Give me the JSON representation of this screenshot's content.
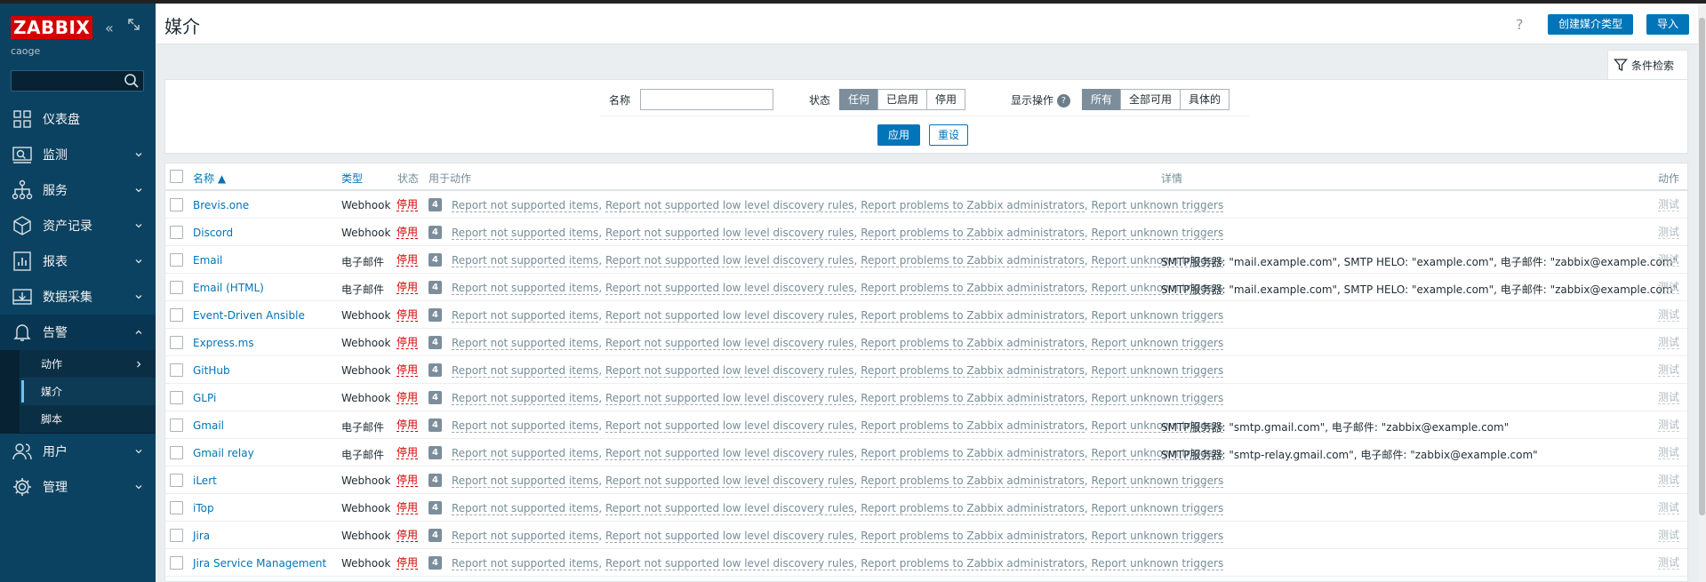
{
  "app": {
    "logo": "ZABBIX",
    "server_name": "caoge"
  },
  "sidebar": {
    "search_placeholder": "",
    "items": [
      {
        "label": "仪表盘",
        "icon": "dashboard-icon"
      },
      {
        "label": "监测",
        "icon": "monitoring-icon"
      },
      {
        "label": "服务",
        "icon": "services-icon"
      },
      {
        "label": "资产记录",
        "icon": "inventory-icon"
      },
      {
        "label": "报表",
        "icon": "reports-icon"
      },
      {
        "label": "数据采集",
        "icon": "data-collection-icon"
      },
      {
        "label": "告警",
        "icon": "bell-icon"
      },
      {
        "label": "用户",
        "icon": "users-icon"
      },
      {
        "label": "管理",
        "icon": "gear-icon"
      }
    ],
    "alerts_sub": [
      {
        "label": "动作"
      },
      {
        "label": "媒介"
      },
      {
        "label": "脚本"
      }
    ]
  },
  "header": {
    "title": "媒介",
    "help": "?",
    "create_button": "创建媒介类型",
    "import_button": "导入"
  },
  "filter": {
    "tab_label": "条件检索",
    "name_label": "名称",
    "name_value": "",
    "status_label": "状态",
    "status_options": [
      "任何",
      "已启用",
      "停用"
    ],
    "status_selected": "任何",
    "show_ops_label": "显示操作",
    "show_ops_help": "?",
    "show_ops_options": [
      "所有",
      "全部可用",
      "具体的"
    ],
    "show_ops_selected": "所有",
    "apply_button": "应用",
    "reset_button": "重设"
  },
  "table": {
    "columns": {
      "name": "名称 ▲",
      "type": "类型",
      "status": "状态",
      "used_in": "用于动作",
      "details": "详情",
      "action": "动作"
    },
    "rows": [
      {
        "name": "Brevis.one",
        "type": "Webhook",
        "status": "停用",
        "count": "4",
        "details": "",
        "test": "测试"
      },
      {
        "name": "Discord",
        "type": "Webhook",
        "status": "停用",
        "count": "4",
        "details": "",
        "test": "测试"
      },
      {
        "name": "Email",
        "type": "电子邮件",
        "status": "停用",
        "count": "4",
        "details": "SMTP服务器: \"mail.example.com\", SMTP HELO: \"example.com\", 电子邮件: \"zabbix@example.com\"",
        "test": "测试"
      },
      {
        "name": "Email (HTML)",
        "type": "电子邮件",
        "status": "停用",
        "count": "4",
        "details": "SMTP服务器: \"mail.example.com\", SMTP HELO: \"example.com\", 电子邮件: \"zabbix@example.com\"",
        "test": "测试"
      },
      {
        "name": "Event-Driven Ansible",
        "type": "Webhook",
        "status": "停用",
        "count": "4",
        "details": "",
        "test": "测试"
      },
      {
        "name": "Express.ms",
        "type": "Webhook",
        "status": "停用",
        "count": "4",
        "details": "",
        "test": "测试"
      },
      {
        "name": "GitHub",
        "type": "Webhook",
        "status": "停用",
        "count": "4",
        "details": "",
        "test": "测试"
      },
      {
        "name": "GLPi",
        "type": "Webhook",
        "status": "停用",
        "count": "4",
        "details": "",
        "test": "测试"
      },
      {
        "name": "Gmail",
        "type": "电子邮件",
        "status": "停用",
        "count": "4",
        "details": "SMTP服务器: \"smtp.gmail.com\", 电子邮件: \"zabbix@example.com\"",
        "test": "测试"
      },
      {
        "name": "Gmail relay",
        "type": "电子邮件",
        "status": "停用",
        "count": "4",
        "details": "SMTP服务器: \"smtp-relay.gmail.com\", 电子邮件: \"zabbix@example.com\"",
        "test": "测试"
      },
      {
        "name": "iLert",
        "type": "Webhook",
        "status": "停用",
        "count": "4",
        "details": "",
        "test": "测试"
      },
      {
        "name": "iTop",
        "type": "Webhook",
        "status": "停用",
        "count": "4",
        "details": "",
        "test": "测试"
      },
      {
        "name": "Jira",
        "type": "Webhook",
        "status": "停用",
        "count": "4",
        "details": "",
        "test": "测试"
      },
      {
        "name": "Jira Service Management",
        "type": "Webhook",
        "status": "停用",
        "count": "4",
        "details": "",
        "test": "测试"
      }
    ],
    "actions": [
      "Report not supported items",
      "Report not supported low level discovery rules",
      "Report problems to Zabbix administrators",
      "Report unknown triggers"
    ],
    "action_sep": ", "
  },
  "colors": {
    "sidebar_bg": "#0b4261",
    "accent": "#0275b8",
    "disabled_red": "#d40000",
    "logo_red": "#d40000"
  }
}
